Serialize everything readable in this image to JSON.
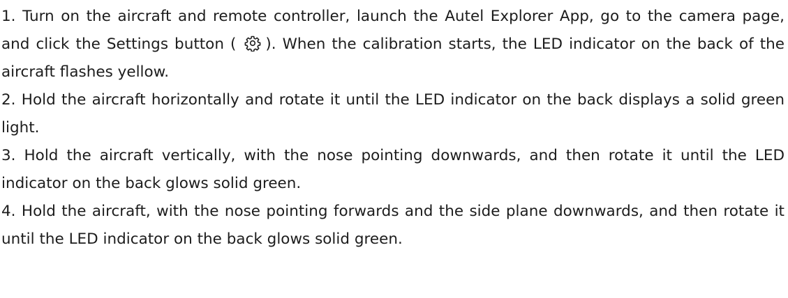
{
  "steps": [
    {
      "prefix": "1. Turn on the aircraft and remote controller, launch the Autel Explorer App, go to the camera page, and click the Settings button (",
      "icon": "gear-icon",
      "suffix": "). When the calibration starts, the LED indicator on the back of the aircraft flashes yellow."
    },
    {
      "text": "2. Hold the aircraft horizontally and rotate it until the LED indicator on the back displays a solid green light."
    },
    {
      "text": "3. Hold the aircraft vertically, with the nose pointing downwards, and then rotate it until the LED indicator on the back glows solid green."
    },
    {
      "text": "4. Hold the aircraft, with the nose pointing forwards and the side plane downwards, and then rotate it until the LED indicator on the back glows solid green."
    }
  ]
}
